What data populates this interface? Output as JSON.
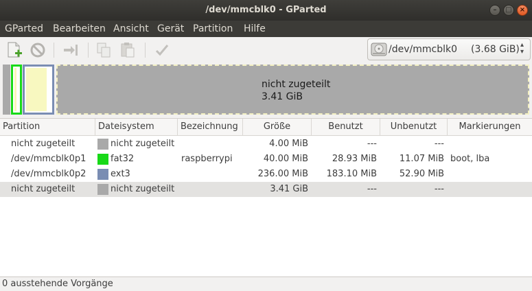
{
  "window": {
    "title": "/dev/mmcblk0 - GParted"
  },
  "menu": [
    "GParted",
    "Bearbeiten",
    "Ansicht",
    "Gerät",
    "Partition",
    "Hilfe"
  ],
  "toolbar": {
    "buttons": [
      "new-partition",
      "delete",
      "resize-move",
      "copy",
      "paste",
      "apply"
    ]
  },
  "device": {
    "name": "/dev/mmcblk0",
    "size": "(3.68 GiB)"
  },
  "visual": {
    "label": "nicht zugeteilt",
    "size": "3.41 GiB"
  },
  "table": {
    "headers": [
      "Partition",
      "Dateisystem",
      "Bezeichnung",
      "Größe",
      "Benutzt",
      "Unbenutzt",
      "Markierungen"
    ],
    "rows": [
      {
        "partition": "nicht zugeteilt",
        "fs": "nicht zugeteilt",
        "fs_color": "#a9a9a9",
        "label": "",
        "size": "4.00 MiB",
        "used": "---",
        "unused": "---",
        "flags": ""
      },
      {
        "partition": "/dev/mmcblk0p1",
        "fs": "fat32",
        "fs_color": "#18d918",
        "label": "raspberrypi",
        "size": "40.00 MiB",
        "used": "28.93 MiB",
        "unused": "11.07 MiB",
        "flags": "boot, lba"
      },
      {
        "partition": "/dev/mmcblk0p2",
        "fs": "ext3",
        "fs_color": "#7a8db3",
        "label": "",
        "size": "236.00 MiB",
        "used": "183.10 MiB",
        "unused": "52.90 MiB",
        "flags": ""
      },
      {
        "partition": "nicht zugeteilt",
        "fs": "nicht zugeteilt",
        "fs_color": "#a9a9a9",
        "label": "",
        "size": "3.41 GiB",
        "used": "---",
        "unused": "---",
        "flags": ""
      }
    ]
  },
  "status": "0 ausstehende Vorgänge"
}
